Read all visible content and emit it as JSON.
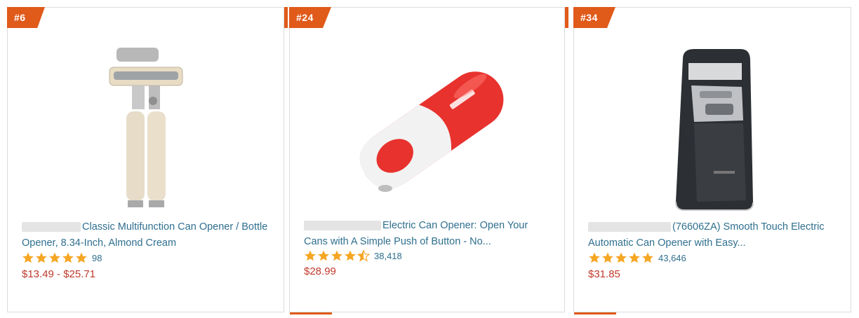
{
  "products": [
    {
      "rank": "#6",
      "title": "Classic Multifunction Can Opener / Bottle Opener, 8.34-Inch, Almond Cream",
      "rating": 5,
      "review_count": "98",
      "price": "$13.49 - $25.71"
    },
    {
      "rank": "#24",
      "title": "Electric Can Opener: Open Your Cans with A Simple Push of Button - No...",
      "rating": 4.5,
      "review_count": "38,418",
      "price": "$28.99"
    },
    {
      "rank": "#34",
      "title": "(76606ZA) Smooth Touch Electric Automatic Can Opener with Easy...",
      "rating": 5,
      "review_count": "43,646",
      "price": "$31.85"
    }
  ],
  "colors": {
    "badge": "#e05a1a",
    "title_link": "#2f6f8f",
    "price": "#c0392b",
    "star": "#f5a623"
  }
}
